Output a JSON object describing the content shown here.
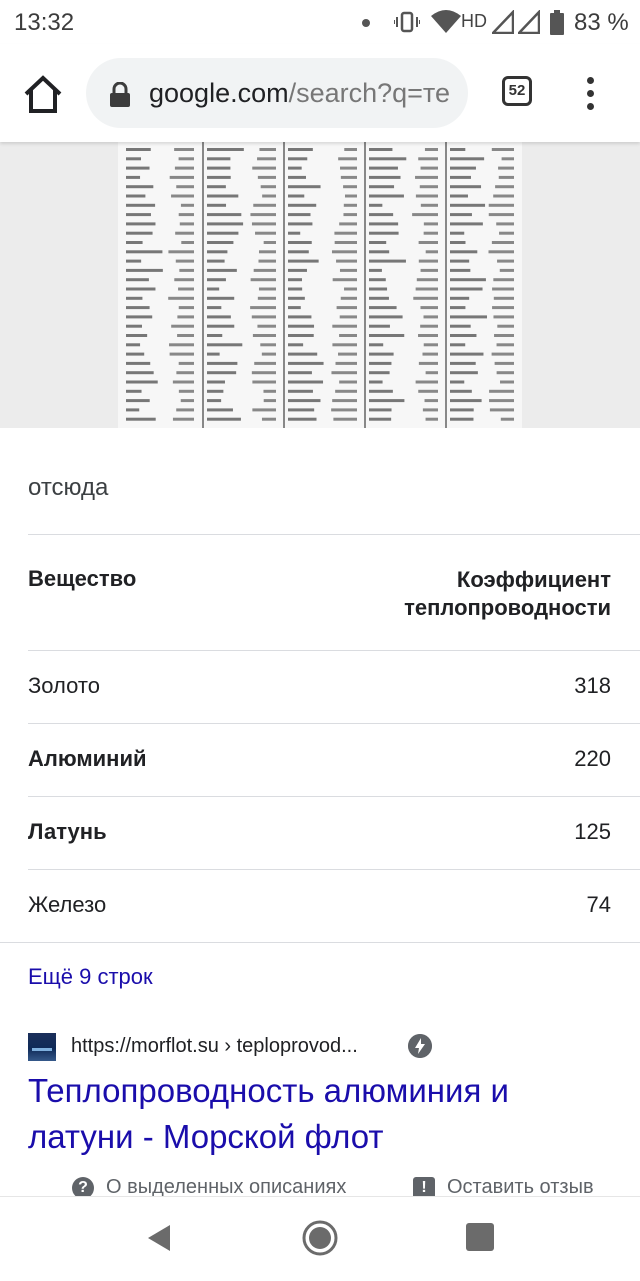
{
  "status_bar": {
    "time": "13:32",
    "network": "HD",
    "battery": "83 %",
    "icons": [
      "vibrate-icon",
      "wifi-icon",
      "signal-icon",
      "battery-icon"
    ]
  },
  "browser": {
    "url_host": "google.com",
    "url_path": "/search?q=те",
    "tab_count": "52",
    "icons": [
      "home-icon",
      "lock-icon",
      "tabs-icon",
      "menu-icon"
    ]
  },
  "snippet": {
    "image_alt": "scanned reference table",
    "source_text": "отсюда",
    "table": {
      "headers": [
        "Вещество",
        "Коэффициент",
        "теплопроводности"
      ],
      "rows": [
        {
          "name": "Золото",
          "value": "318",
          "bold": false
        },
        {
          "name": "Алюминий",
          "value": "220",
          "bold": true
        },
        {
          "name": "Латунь",
          "value": "125",
          "bold": true
        },
        {
          "name": "Железо",
          "value": "74",
          "bold": false
        }
      ]
    },
    "more_rows": "Ещё 9 строк"
  },
  "result": {
    "url": "https://morflot.su › teploprovod...",
    "title": "Теплопроводность алюминия и латуни - Морской флот",
    "footer_about": "О выделенных описаниях",
    "footer_feedback": "Оставить отзыв"
  },
  "colors": {
    "link": "#1a0dab",
    "text": "#202124",
    "secondary": "#5f6368",
    "divider": "#dadce0"
  }
}
